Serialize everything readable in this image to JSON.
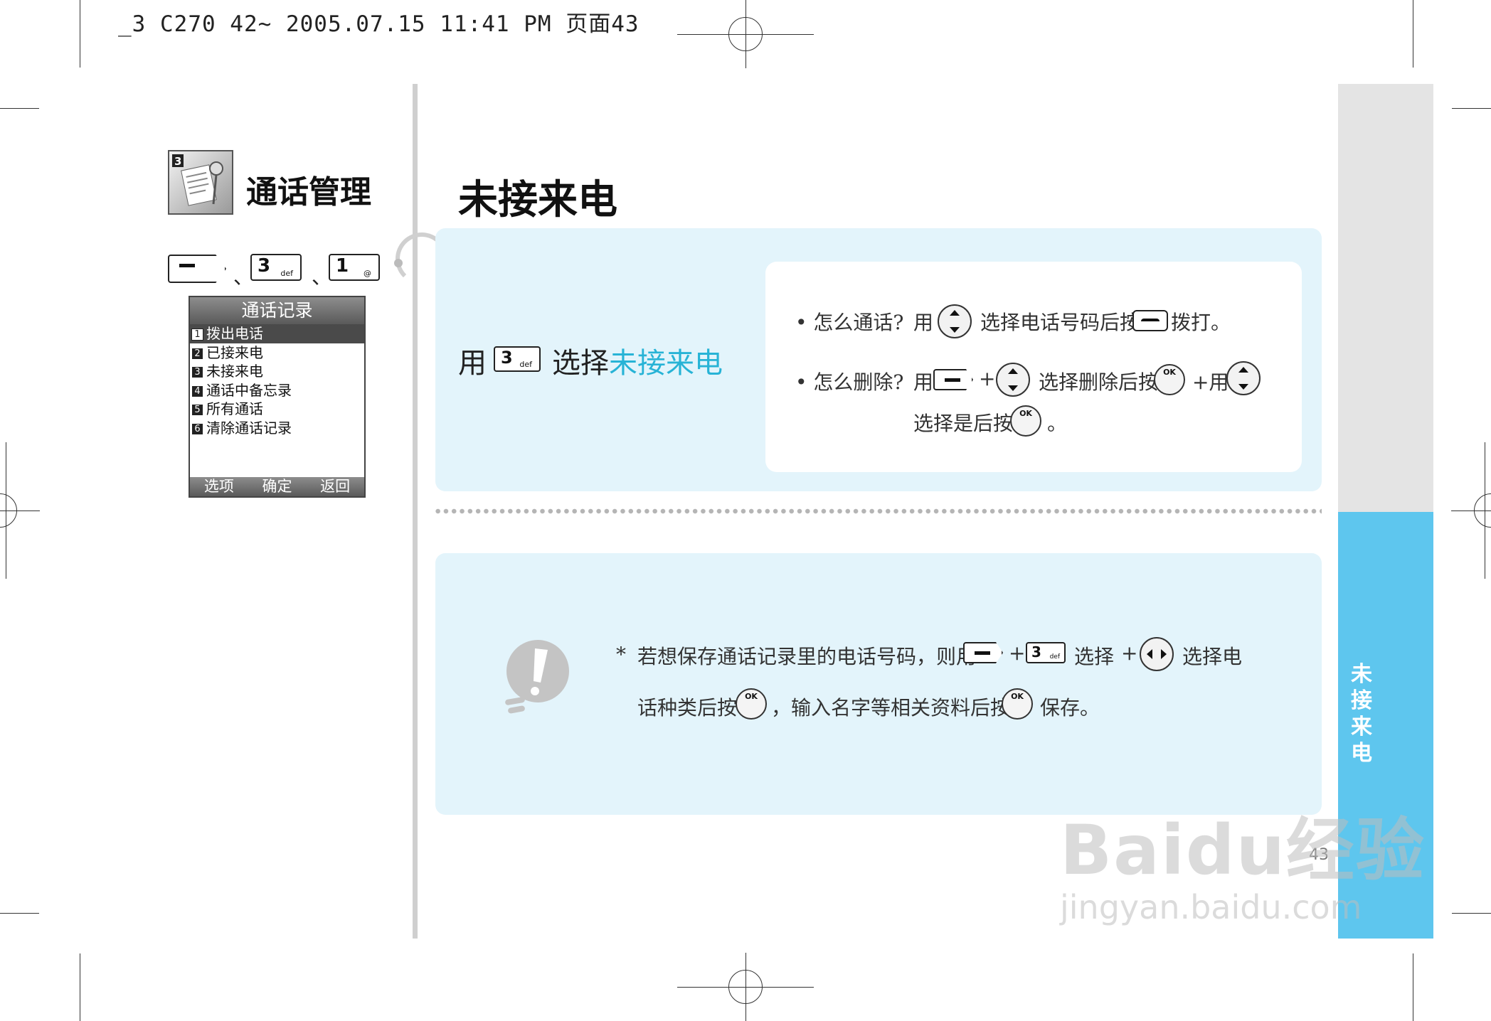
{
  "print_header": "_3 C270 42~ 2005.07.15 11:41 PM 页面43",
  "section": {
    "title": "通话管理",
    "icon": "call-log-icon",
    "key_path": {
      "soft_key_icon": "left-soft-key-icon",
      "separator": "、",
      "key1": {
        "digit": "3",
        "sub": "def"
      },
      "key2": {
        "digit": "1",
        "sub": "@"
      }
    }
  },
  "phone_screen": {
    "title": "通话记录",
    "items": [
      {
        "num": "1",
        "label": "拨出电话"
      },
      {
        "num": "2",
        "label": "已接来电"
      },
      {
        "num": "3",
        "label": "未接来电"
      },
      {
        "num": "4",
        "label": "通话中备忘录"
      },
      {
        "num": "5",
        "label": "所有通话"
      },
      {
        "num": "6",
        "label": "清除通话记录"
      }
    ],
    "selected_index": 0,
    "softkeys": [
      "选项",
      "确定",
      "返回"
    ]
  },
  "main": {
    "heading": "未接来电",
    "instruction": {
      "prefix": "用",
      "key": {
        "digit": "3",
        "sub": "def"
      },
      "middle": "选择",
      "highlight": "未接来电"
    },
    "tips": {
      "call": {
        "label": "怎么通话?",
        "use": "用",
        "t1": "选择电话号码后按",
        "t2": "拨打。"
      },
      "delete": {
        "label": "怎么删除?",
        "use": "用",
        "plus": "+",
        "t1": "选择删除后按",
        "t2": "+用",
        "line2": "选择是后按",
        "end": "。"
      }
    },
    "note": {
      "icon": "exclamation-bulb-icon",
      "star": "*",
      "l1a": "若想保存通话记录里的电话号码，则用",
      "plus": "+",
      "l1b": "选择",
      "l1c": "选择电",
      "l2a": "话种类后按",
      "l2b": "，输入名字等相关资料后按",
      "l2c": "保存。",
      "key": {
        "digit": "3",
        "sub": "def"
      }
    },
    "ok_label": "OK"
  },
  "side_tab": {
    "label_chars": [
      "未",
      "接",
      "来",
      "电"
    ]
  },
  "page_number": "43",
  "watermark": {
    "main": "Baidu经验",
    "sub": "jingyan.baidu.com"
  },
  "colors": {
    "accent": "#27b3d6",
    "panel": "#e3f4fb",
    "side_tab_blue": "#5ec6ee",
    "side_tab_grey": "#e4e4e4"
  }
}
